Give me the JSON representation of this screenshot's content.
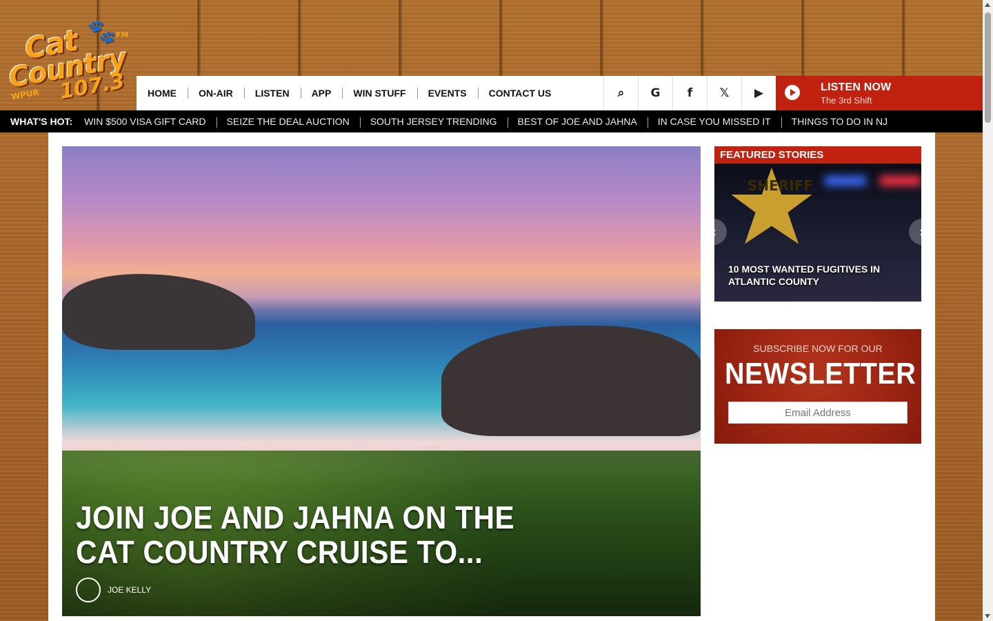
{
  "logo": {
    "line1": "Cat",
    "line2": "Country",
    "frequency": "107.3",
    "call_sign": "WPUR",
    "band": "FM"
  },
  "nav": {
    "items": [
      "HOME",
      "ON-AIR",
      "LISTEN",
      "APP",
      "WIN STUFF",
      "EVENTS",
      "CONTACT US"
    ],
    "icons": [
      "search-icon",
      "google-icon",
      "facebook-icon",
      "x-icon",
      "youtube-icon"
    ],
    "icon_glyphs": [
      "⌕",
      "G",
      "f",
      "𝕏",
      "▶"
    ]
  },
  "listen_now": {
    "title": "LISTEN NOW",
    "subtitle": "The 3rd Shift"
  },
  "whats_hot": {
    "label": "WHAT'S HOT:",
    "items": [
      "WIN $500 VISA GIFT CARD",
      "SEIZE THE DEAL AUCTION",
      "SOUTH JERSEY TRENDING",
      "BEST OF JOE AND JAHNA",
      "IN CASE YOU MISSED IT",
      "THINGS TO DO IN NJ"
    ]
  },
  "hero": {
    "title": "JOIN JOE AND JAHNA ON THE CAT COUNTRY CRUISE TO...",
    "author": "JOE KELLY"
  },
  "featured": {
    "header": "FEATURED STORIES",
    "badge_text": "SHERIFF",
    "story_title": "10 MOST WANTED FUGITIVES IN ATLANTIC COUNTY"
  },
  "newsletter": {
    "subtitle": "SUBSCRIBE NOW FOR OUR",
    "title": "NEWSLETTER",
    "email_placeholder": "Email Address"
  },
  "colors": {
    "accent_red": "#c1220f",
    "logo_orange": "#f7a21b"
  }
}
